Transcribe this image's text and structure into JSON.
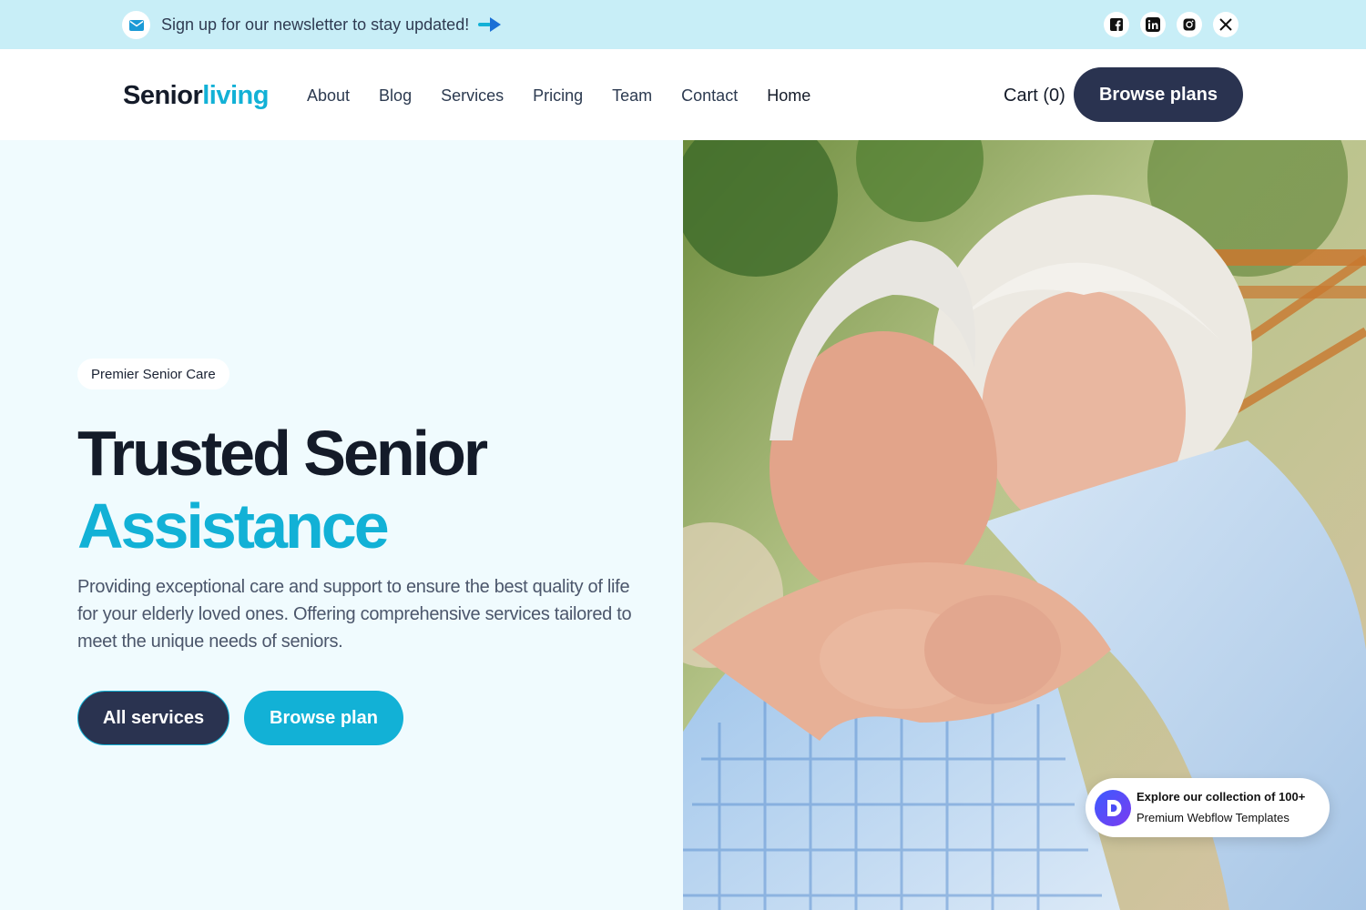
{
  "topbar": {
    "newsletter_text": "Sign up for our newsletter to stay updated!",
    "icons": [
      "mail-icon",
      "arrow-right-icon"
    ],
    "socials": [
      "facebook-icon",
      "linkedin-icon",
      "instagram-icon",
      "x-icon"
    ]
  },
  "header": {
    "logo_part1": "Senior",
    "logo_part2": "living",
    "nav": [
      "About",
      "Blog",
      "Services",
      "Pricing",
      "Team",
      "Contact",
      "Home"
    ],
    "cart_label": "Cart (0)",
    "cta_label": "Browse plans"
  },
  "hero": {
    "badge": "Premier Senior Care",
    "title_line1": "Trusted Senior",
    "title_line2": "Assistance",
    "description": "Providing exceptional care and support to ensure the best quality of life for your elderly loved ones. Offering comprehensive services tailored to meet the unique needs of seniors.",
    "primary_button": "All services",
    "secondary_button": "Browse plan"
  },
  "promo": {
    "line1": "Explore our collection of 100+",
    "line2": "Premium Webflow Templates"
  },
  "colors": {
    "accent": "#12b1d6",
    "dark": "#2a3350",
    "topbar_bg": "#c8eef7",
    "hero_bg": "#f0fbfe"
  }
}
